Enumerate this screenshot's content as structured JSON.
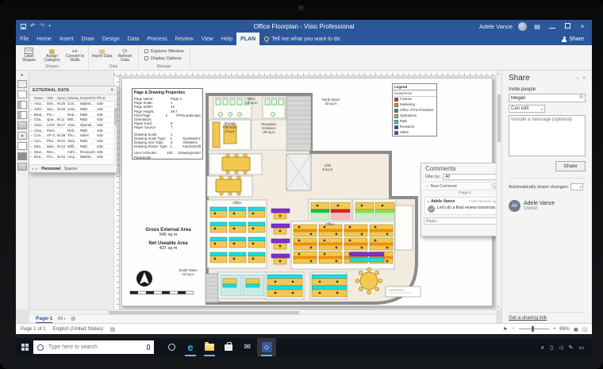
{
  "window": {
    "title": "Office Floorplan - Visio Professional",
    "user_name": "Adele Vance"
  },
  "ribbon": {
    "tabs": [
      "File",
      "Home",
      "Insert",
      "Draw",
      "Design",
      "Data",
      "Process",
      "Review",
      "View",
      "Help",
      "PLAN"
    ],
    "active_tab": "PLAN",
    "tell_me": "Tell me what you want to do",
    "share_label": "Share",
    "groups": [
      {
        "name": "Shapes",
        "buttons": [
          "Label Shapes",
          "Assign Category",
          "Convert to Walls"
        ]
      },
      {
        "name": "Data",
        "buttons": [
          "Import Data",
          "Refresh Data"
        ]
      },
      {
        "name": "Manage",
        "checkboxes": [
          "Explorer Window",
          "Display Options"
        ]
      }
    ]
  },
  "external_data": {
    "title": "EXTERNAL DATA",
    "columns": [
      "Name",
      "Title",
      "Space",
      "(Manag",
      "Departme",
      "Phon"
    ],
    "rows": [
      [
        "Amy...",
        "Dire...",
        "W.35",
        "Con...",
        "Market...",
        "425-"
      ],
      [
        "Ashl...",
        "Sen...",
        "W.29",
        "Joss...",
        "R&D",
        "425-"
      ],
      [
        "Brad...",
        "Pre...",
        "",
        "Rob...",
        "R&D",
        "425-"
      ],
      [
        "Cha...",
        "Que...",
        "W.11",
        "Will...",
        "R&D",
        "425-"
      ],
      [
        "Clair...",
        "COO",
        "W.27",
        "Joss...",
        "Operati...",
        "425-"
      ],
      [
        "Clau...",
        "Post...",
        "",
        "Rob...",
        "R&D",
        "425-"
      ],
      [
        "Con...",
        "VP S...",
        "W.39",
        "Tho...",
        "Sales",
        "425-"
      ],
      [
        "Cyn...",
        "Pha...",
        "W.02",
        "Step...",
        "R&D",
        "425-"
      ],
      [
        "Dan...",
        "Man...",
        "W.10",
        "Willi...",
        "R&D",
        "425-"
      ],
      [
        "Davi...",
        "Res...",
        "",
        "Ashl...",
        "Research",
        "425-"
      ],
      [
        "Dea...",
        "Pro...",
        "W.34",
        "Amy...",
        "Market...",
        "425-"
      ]
    ],
    "sheet_tabs": [
      "Personnel",
      "Spaces"
    ],
    "active_sheet": "Personnel"
  },
  "props_box": {
    "title": "Page & Drawing Properties",
    "rows": [
      {
        "l": "Page Name:",
        "v": "Page-1",
        "e": ""
      },
      {
        "l": "Page Scale:",
        "v": "1",
        "e": ""
      },
      {
        "l": "Page Width:",
        "v": "42",
        "e": ""
      },
      {
        "l": "Page Height:",
        "v": "29.7",
        "e": ""
      },
      {
        "l": "Print Page Orientation:",
        "v": "2",
        "e": "PPOLandscape"
      },
      {
        "l": "Paper Kind:",
        "v": "9",
        "e": ""
      },
      {
        "l": "Paper Source:",
        "v": "7",
        "e": ""
      },
      {
        "l": "",
        "v": "",
        "e": ""
      },
      {
        "l": "Drawing Scale:",
        "v": "1",
        "e": ""
      },
      {
        "l": "Drawing Scale Type:",
        "v": "4",
        "e": "ScaleMetric"
      },
      {
        "l": "Drawing Size Type:",
        "v": "5",
        "e": "DSMetric"
      },
      {
        "l": "Drawing Resize Type:",
        "v": "1",
        "e": "AutoSizeOff"
      },
      {
        "l": "",
        "v": "",
        "e": ""
      },
      {
        "l": "User.ArtiScale:",
        "v": "100",
        "e": "DrawingScale/"
      },
      {
        "l": "PageScale",
        "v": "",
        "e": ""
      }
    ]
  },
  "legend": {
    "title": "Legend",
    "subtitle": "Department",
    "entries": [
      {
        "label": "Finance",
        "color": "#ed1c24"
      },
      {
        "label": "Marketing",
        "color": "#ff8c00"
      },
      {
        "label": "Office of the President",
        "color": "#00b050"
      },
      {
        "label": "Operations",
        "color": "#92d050"
      },
      {
        "label": "R&D",
        "color": "#00e5e5"
      },
      {
        "label": "Research",
        "color": "#3a3aad"
      },
      {
        "label": "Sales",
        "color": "#7a1fd0"
      }
    ]
  },
  "plan": {
    "rooms": [
      {
        "id": "wcs",
        "lines": [
          "WCs",
          "29 sq m"
        ]
      },
      {
        "id": "north-stairs",
        "lines": [
          "North Stairs",
          "33 sq m"
        ]
      },
      {
        "id": "storage",
        "lines": [
          "Storage",
          "File store",
          "3 sq m"
        ]
      },
      {
        "id": "reception",
        "lines": [
          "Reception",
          "Entrance",
          "30 sq m"
        ]
      },
      {
        "id": "lifts",
        "lines": [
          "Lifts",
          "9 sq m"
        ]
      },
      {
        "id": "south-stairs",
        "lines": [
          "South Stairs",
          "13 sq m"
        ]
      },
      {
        "id": "office-left",
        "lines": [
          "Office"
        ]
      },
      {
        "id": "office-right",
        "lines": [
          "Office"
        ]
      }
    ],
    "gross_label": "Gross External Area",
    "gross_value": "545 sq m",
    "net_label": "Net Useable Area",
    "net_value": "437 sq m"
  },
  "comments": {
    "title": "Comments",
    "filter_label": "Filter by:",
    "filter_value": "All",
    "new_comment": "New Comment",
    "page_divider": "Page-1",
    "author": "Adele Vance",
    "time": "A few seconds ago",
    "text": "Let's do a final review tomorrow.",
    "reply_placeholder": "Reply...",
    "initials": "AV"
  },
  "share": {
    "title": "Share",
    "invite_label": "Invite people",
    "invite_value": "Megan",
    "permission": "Can edit",
    "message_placeholder": "Include a message (optional)",
    "share_button": "Share",
    "auto_label": "Automatically share changes:",
    "owner_name": "Adele Vance",
    "owner_role": "Owner",
    "owner_initials": "AV",
    "link": "Get a sharing link"
  },
  "pagebar": {
    "page_tab": "Page-1",
    "all": "All"
  },
  "statusbar": {
    "page": "Page 1 of 1",
    "language": "English (United States)",
    "zoom": "65%"
  },
  "taskbar": {
    "search_placeholder": "Type here to search"
  },
  "colors": {
    "accent": "#2b579a",
    "desk_yellow": "#f4c84f",
    "wall_gray": "#8c8c8c",
    "rd_cyan": "#19dede",
    "sales_purple": "#7d2fd4",
    "marketing_orange": "#ff9500"
  }
}
